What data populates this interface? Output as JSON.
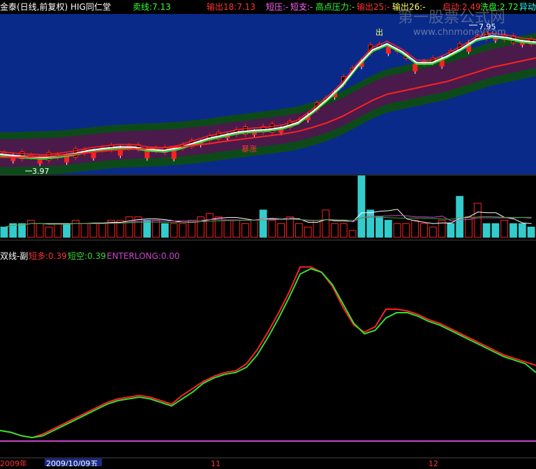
{
  "header": {
    "title": "金泰(日线,前复权) HIG同仁堂",
    "items": [
      {
        "label": "卖线:7.13",
        "color": "#33ff33"
      },
      {
        "label": "输出18:7.13",
        "color": "#ff3333"
      },
      {
        "label": "短压:-",
        "color": "#ff66ff"
      },
      {
        "label": "短支:-",
        "color": "#ff66ff"
      },
      {
        "label": "高点压力:-",
        "color": "#33ff33"
      },
      {
        "label": "输出25:-",
        "color": "#ff3333"
      },
      {
        "label": "输出26:-",
        "color": "#ffff66"
      },
      {
        "label": "启动:2.49",
        "color": "#ff3333"
      },
      {
        "label": "洗盘:2.72",
        "color": "#33ff33"
      },
      {
        "label": "异动",
        "color": "#33ffff"
      }
    ]
  },
  "annotations": {
    "out_label": "出",
    "high_label": "7.95",
    "low_label": "3.97",
    "boom_label": "暴涨",
    "watermark_cn": "第一股票公式网",
    "watermark_url": "www.chnmoney.com"
  },
  "colors": {
    "band_blue": "#0a2a8a",
    "up": "#ff2020",
    "down": "#33cccc",
    "macd_short_long": "#ff2020",
    "macd_short_short": "#33dd33",
    "enterlong": "#cc44cc"
  },
  "indicator_header": {
    "name": "双线-副",
    "short_long_label": "短多:0.39",
    "short_short_label": "短空:0.39",
    "enterlong_label": "ENTERLONG:0.00"
  },
  "x_axis": {
    "labels": [
      {
        "text": "2009年",
        "pos": "left"
      },
      {
        "text": "2009/10/09五",
        "pos": "cursor"
      },
      {
        "text": "11",
        "pos": "month"
      },
      {
        "text": "12",
        "pos": "month"
      }
    ]
  },
  "chart_data": [
    {
      "type": "line",
      "title": "主图",
      "ylim": [
        3.5,
        8.5
      ],
      "series": [
        {
          "name": "白线",
          "values": [
            4.1,
            4.05,
            4.02,
            4.0,
            4.05,
            4.12,
            4.22,
            4.28,
            4.33,
            4.32,
            4.25,
            4.22,
            4.3,
            4.45,
            4.6,
            4.7,
            4.8,
            4.85,
            4.88,
            4.95,
            5.1,
            5.45,
            5.85,
            6.3,
            6.9,
            7.4,
            7.6,
            7.35,
            7.0,
            7.0,
            7.2,
            7.45,
            7.75,
            7.85,
            7.8,
            7.7,
            7.65
          ]
        },
        {
          "name": "红线",
          "values": [
            4.0,
            4.0,
            4.02,
            4.03,
            4.05,
            4.1,
            4.15,
            4.2,
            4.24,
            4.26,
            4.28,
            4.3,
            4.33,
            4.38,
            4.43,
            4.5,
            4.56,
            4.62,
            4.68,
            4.74,
            4.82,
            4.95,
            5.1,
            5.3,
            5.55,
            5.8,
            6.0,
            6.1,
            6.2,
            6.3,
            6.4,
            6.55,
            6.7,
            6.85,
            6.95,
            7.05,
            7.15
          ]
        }
      ]
    },
    {
      "type": "bar",
      "title": "成交量",
      "values": [
        3,
        4,
        4,
        5,
        4,
        3,
        4,
        4,
        5,
        4,
        4,
        4,
        5,
        5,
        6,
        6,
        5,
        5,
        4,
        4,
        4,
        5,
        6,
        7,
        6,
        5,
        5,
        4,
        5,
        8,
        5,
        4,
        6,
        4,
        3,
        5,
        8,
        4,
        4,
        2,
        18,
        8,
        6,
        5,
        4,
        4,
        5,
        4,
        3,
        5,
        4,
        12,
        6,
        10,
        4,
        4,
        5,
        4,
        4,
        3
      ],
      "down_flags": [
        1,
        1,
        1,
        0,
        0,
        0,
        0,
        1,
        0,
        0,
        0,
        0,
        0,
        0,
        0,
        0,
        1,
        0,
        1,
        0,
        0,
        0,
        0,
        0,
        0,
        0,
        0,
        0,
        0,
        1,
        0,
        0,
        0,
        0,
        0,
        0,
        0,
        0,
        0,
        0,
        1,
        1,
        1,
        1,
        0,
        0,
        0,
        0,
        0,
        0,
        1,
        1,
        0,
        0,
        1,
        1,
        0,
        1,
        1,
        1
      ]
    },
    {
      "type": "line",
      "title": "双线-副",
      "ylim": [
        0,
        1.0
      ],
      "x": [
        0,
        1,
        2,
        3,
        4,
        5,
        6,
        7,
        8,
        9,
        10,
        11,
        12,
        13,
        14,
        15,
        16,
        17,
        18,
        19,
        20,
        21,
        22,
        23,
        24,
        25,
        26,
        27,
        28,
        29,
        30,
        31,
        32,
        33,
        34,
        35,
        36,
        37,
        38,
        39,
        40,
        41,
        42,
        43,
        44,
        45,
        46,
        47,
        48,
        49,
        50
      ],
      "series": [
        {
          "name": "短多",
          "values": [
            0.06,
            0.05,
            0.03,
            0.02,
            0.04,
            0.07,
            0.1,
            0.13,
            0.16,
            0.19,
            0.22,
            0.24,
            0.25,
            0.26,
            0.25,
            0.23,
            0.21,
            0.26,
            0.3,
            0.34,
            0.37,
            0.39,
            0.4,
            0.44,
            0.52,
            0.62,
            0.73,
            0.85,
            0.99,
            0.99,
            0.96,
            0.88,
            0.76,
            0.66,
            0.62,
            0.65,
            0.75,
            0.75,
            0.74,
            0.72,
            0.69,
            0.67,
            0.64,
            0.61,
            0.58,
            0.55,
            0.52,
            0.49,
            0.47,
            0.45,
            0.43
          ]
        },
        {
          "name": "短空",
          "values": [
            0.06,
            0.05,
            0.03,
            0.02,
            0.03,
            0.06,
            0.09,
            0.12,
            0.15,
            0.18,
            0.21,
            0.23,
            0.24,
            0.25,
            0.24,
            0.22,
            0.2,
            0.24,
            0.28,
            0.33,
            0.36,
            0.38,
            0.39,
            0.42,
            0.49,
            0.59,
            0.7,
            0.82,
            0.95,
            0.98,
            0.96,
            0.89,
            0.78,
            0.67,
            0.61,
            0.63,
            0.7,
            0.73,
            0.73,
            0.71,
            0.68,
            0.66,
            0.63,
            0.6,
            0.57,
            0.54,
            0.51,
            0.48,
            0.46,
            0.44,
            0.39
          ]
        },
        {
          "name": "ENTERLONG",
          "values": [
            0,
            0,
            0,
            0,
            0,
            0,
            0,
            0,
            0,
            0,
            0,
            0,
            0,
            0,
            0,
            0,
            0,
            0,
            0,
            0,
            0,
            0,
            0,
            0,
            0,
            0,
            0,
            0,
            0,
            0,
            0,
            0,
            0,
            0,
            0,
            0,
            0,
            0,
            0,
            0,
            0,
            0,
            0,
            0,
            0,
            0,
            0,
            0,
            0,
            0,
            0
          ]
        }
      ]
    }
  ]
}
